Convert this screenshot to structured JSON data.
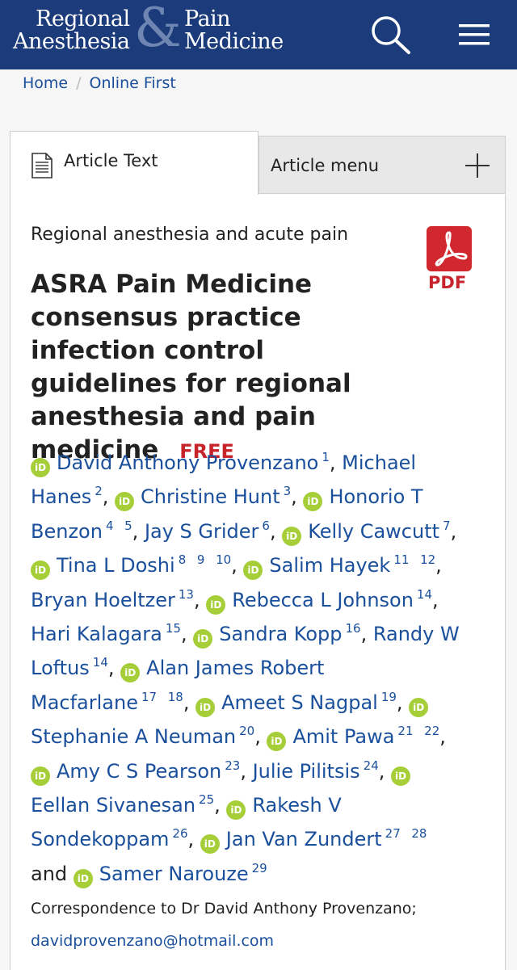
{
  "header": {
    "logo": {
      "line1": "Regional",
      "line2": "Anesthesia",
      "amp": "&",
      "line3": "Pain",
      "line4": "Medicine"
    },
    "search_icon": "search-icon",
    "menu_icon": "hamburger-menu-icon",
    "bg_color": "#1b3b7a"
  },
  "breadcrumb": {
    "home": "Home",
    "separator": "/",
    "current": "Online First"
  },
  "tabs": {
    "article_text": "Article Text",
    "article_menu": "Article menu"
  },
  "article": {
    "category": "Regional anesthesia and acute pain",
    "title": "ASRA Pain Medicine consensus practice infection control guidelines for regional anesthesia and pain medicine",
    "free_badge": "FREE",
    "pdf_label": "PDF",
    "orcid_label": "iD",
    "authors": [
      {
        "name": "David Anthony Provenzano",
        "orcid": true,
        "sup": [
          "1"
        ]
      },
      {
        "name": "Michael Hanes",
        "orcid": false,
        "sup": [
          "2"
        ]
      },
      {
        "name": "Christine Hunt",
        "orcid": true,
        "sup": [
          "3"
        ]
      },
      {
        "name": "Honorio T Benzon",
        "orcid": true,
        "sup": [
          "4",
          "5"
        ]
      },
      {
        "name": "Jay S Grider",
        "orcid": false,
        "sup": [
          "6"
        ]
      },
      {
        "name": "Kelly Cawcutt",
        "orcid": true,
        "sup": [
          "7"
        ]
      },
      {
        "name": "Tina L Doshi",
        "orcid": true,
        "sup": [
          "8",
          "9",
          "10"
        ]
      },
      {
        "name": "Salim Hayek",
        "orcid": true,
        "sup": [
          "11",
          "12"
        ]
      },
      {
        "name": "Bryan Hoeltzer",
        "orcid": false,
        "sup": [
          "13"
        ]
      },
      {
        "name": "Rebecca L Johnson",
        "orcid": true,
        "sup": [
          "14"
        ]
      },
      {
        "name": "Hari Kalagara",
        "orcid": false,
        "sup": [
          "15"
        ]
      },
      {
        "name": "Sandra Kopp",
        "orcid": true,
        "sup": [
          "16"
        ]
      },
      {
        "name": "Randy W Loftus",
        "orcid": false,
        "sup": [
          "14"
        ]
      },
      {
        "name": "Alan James Robert Macfarlane",
        "orcid": true,
        "sup": [
          "17",
          "18"
        ]
      },
      {
        "name": "Ameet S Nagpal",
        "orcid": true,
        "sup": [
          "19"
        ]
      },
      {
        "name": "Stephanie A Neuman",
        "orcid": true,
        "sup": [
          "20"
        ]
      },
      {
        "name": "Amit Pawa",
        "orcid": true,
        "sup": [
          "21",
          "22"
        ]
      },
      {
        "name": "Amy C S Pearson",
        "orcid": true,
        "sup": [
          "23"
        ]
      },
      {
        "name": "Julie Pilitsis",
        "orcid": false,
        "sup": [
          "24"
        ]
      },
      {
        "name": "Eellan Sivanesan",
        "orcid": true,
        "sup": [
          "25"
        ]
      },
      {
        "name": "Rakesh V Sondekoppam",
        "orcid": true,
        "sup": [
          "26"
        ]
      },
      {
        "name": "Jan Van Zundert",
        "orcid": true,
        "sup": [
          "27",
          "28"
        ]
      },
      {
        "name": "Samer Narouze",
        "orcid": true,
        "sup": [
          "29"
        ]
      }
    ],
    "and_word": "and",
    "correspondence": "Correspondence to Dr David Anthony Provenzano;",
    "email": "davidprovenzano@hotmail.com"
  },
  "colors": {
    "link": "#1a4f9c",
    "accent_red": "#c8242c",
    "orcid_green": "#a6ce39"
  }
}
